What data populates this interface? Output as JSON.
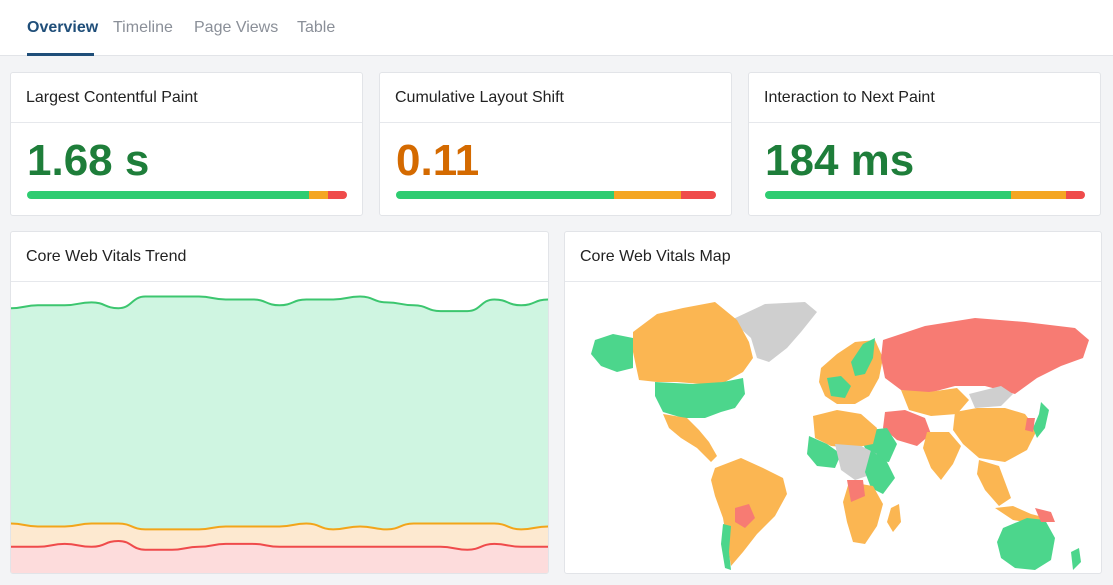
{
  "tabs": [
    {
      "label": "Overview",
      "active": true
    },
    {
      "label": "Timeline",
      "active": false
    },
    {
      "label": "Page Views",
      "active": false
    },
    {
      "label": "Table",
      "active": false
    }
  ],
  "colors": {
    "good": "#2ecc71",
    "needs_improvement": "#f4a623",
    "poor": "#ef4b4b",
    "good_text": "#1e7e3a",
    "ni_text": "#d46a00",
    "accent": "#1f4e79"
  },
  "metrics": [
    {
      "title": "Largest Contentful Paint",
      "value": "1.68 s",
      "rating": "good",
      "distribution": {
        "good": 0.88,
        "needs_improvement": 0.06,
        "poor": 0.06
      }
    },
    {
      "title": "Cumulative Layout Shift",
      "value": "0.11",
      "rating": "needs_improvement",
      "distribution": {
        "good": 0.68,
        "needs_improvement": 0.21,
        "poor": 0.11
      }
    },
    {
      "title": "Interaction to Next Paint",
      "value": "184 ms",
      "rating": "good",
      "distribution": {
        "good": 0.77,
        "needs_improvement": 0.17,
        "poor": 0.06
      }
    }
  ],
  "trend": {
    "title": "Core Web Vitals Trend",
    "chart_data": {
      "type": "area",
      "stacked": true,
      "ylim": [
        0,
        100
      ],
      "x": [
        0,
        1,
        2,
        3,
        4,
        5,
        6,
        7,
        8,
        9,
        10,
        11,
        12,
        13,
        14,
        15,
        16,
        17,
        18,
        19,
        20
      ],
      "series": [
        {
          "values": [
            91,
            92,
            92,
            93,
            91,
            95,
            95,
            95,
            94,
            94,
            92,
            94,
            94,
            95,
            93,
            92,
            90,
            90,
            94,
            92,
            94
          ]
        },
        {
          "values": [
            17,
            16,
            16,
            17,
            17,
            15,
            15,
            15,
            16,
            16,
            16,
            17,
            15,
            16,
            15,
            17,
            17,
            17,
            17,
            15,
            16
          ]
        },
        {
          "values": [
            9,
            9,
            10,
            9,
            11,
            8,
            8,
            9,
            10,
            10,
            9,
            9,
            9,
            9,
            9,
            9,
            9,
            8,
            10,
            9,
            9
          ]
        }
      ]
    }
  },
  "map": {
    "title": "Core Web Vitals Map"
  }
}
